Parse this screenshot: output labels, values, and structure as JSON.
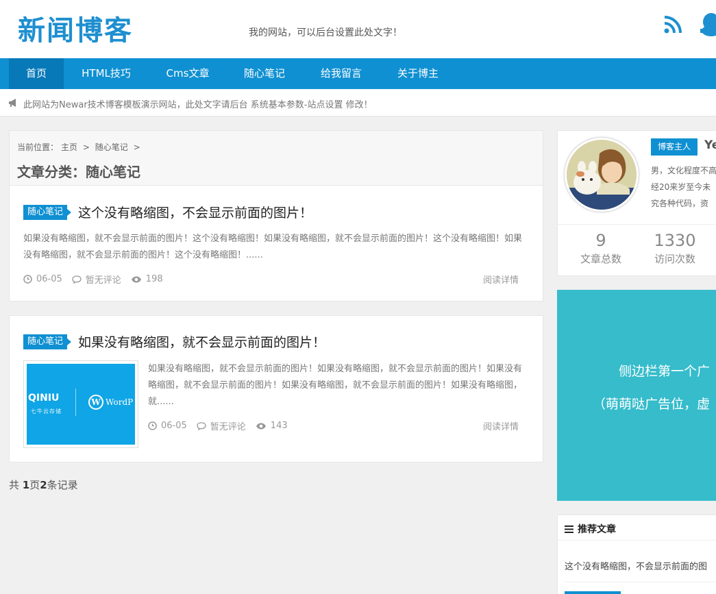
{
  "header": {
    "logo": "新闻博客",
    "tagline": "我的网站，可以后台设置此处文字！"
  },
  "nav": {
    "items": [
      "首页",
      "HTML技巧",
      "Cms文章",
      "随心笔记",
      "给我留言",
      "关于博主"
    ]
  },
  "notice": {
    "text": "此网站为Newar技术博客模板演示网站，此处文字请后台 系统基本参数-站点设置 修改！"
  },
  "breadcrumb": {
    "prefix": "当前位置：",
    "home": "主页",
    "sep": ">",
    "category": "随心笔记"
  },
  "category_title": "文章分类：随心笔记",
  "articles": [
    {
      "tag": "随心笔记",
      "title": "这个没有略缩图，不会显示前面的图片！",
      "excerpt": "如果没有略缩图，就不会显示前面的图片！这个没有略缩图！如果没有略缩图，就不会显示前面的图片！这个没有略缩图！如果没有略缩图，就不会显示前面的图片！这个没有略缩图！......",
      "date": "06-05",
      "comments": "暂无评论",
      "views": "198",
      "read_more": "阅读详情"
    },
    {
      "tag": "随心笔记",
      "title": "如果没有略缩图，就不会显示前面的图片！",
      "excerpt": "如果没有略缩图，就不会显示前面的图片！如果没有略缩图，就不会显示前面的图片！如果没有略缩图，就不会显示前面的图片！如果没有略缩图，就不会显示前面的图片！如果没有略缩图，就......",
      "date": "06-05",
      "comments": "暂无评论",
      "views": "143",
      "read_more": "阅读详情",
      "thumb_left_text": "QINIU",
      "thumb_left_sub": "七牛云存储",
      "thumb_right_text": "WordP"
    }
  ],
  "pager": {
    "total_label_1": "共 ",
    "pages": "1",
    "total_label_2": "页",
    "records": "2",
    "total_label_3": "条记录"
  },
  "profile": {
    "badge": "博客主人",
    "name": "Ye",
    "bio_lines": [
      "男，文化程度不高",
      "经20来岁至今未",
      "究各种代码，资"
    ],
    "stats": [
      {
        "num": "9",
        "label": "文章总数"
      },
      {
        "num": "1330",
        "label": "访问次数"
      }
    ]
  },
  "ad": {
    "line1": "侧边栏第一个广",
    "line2": "（萌萌哒广告位，虚"
  },
  "recommended": {
    "heading": "推荐文章",
    "items": [
      "这个没有略缩图，不会显示前面的图"
    ]
  },
  "colors": {
    "primary": "#0f90d2",
    "nav_active": "#0779b8",
    "ad_bg": "#36bccb"
  }
}
